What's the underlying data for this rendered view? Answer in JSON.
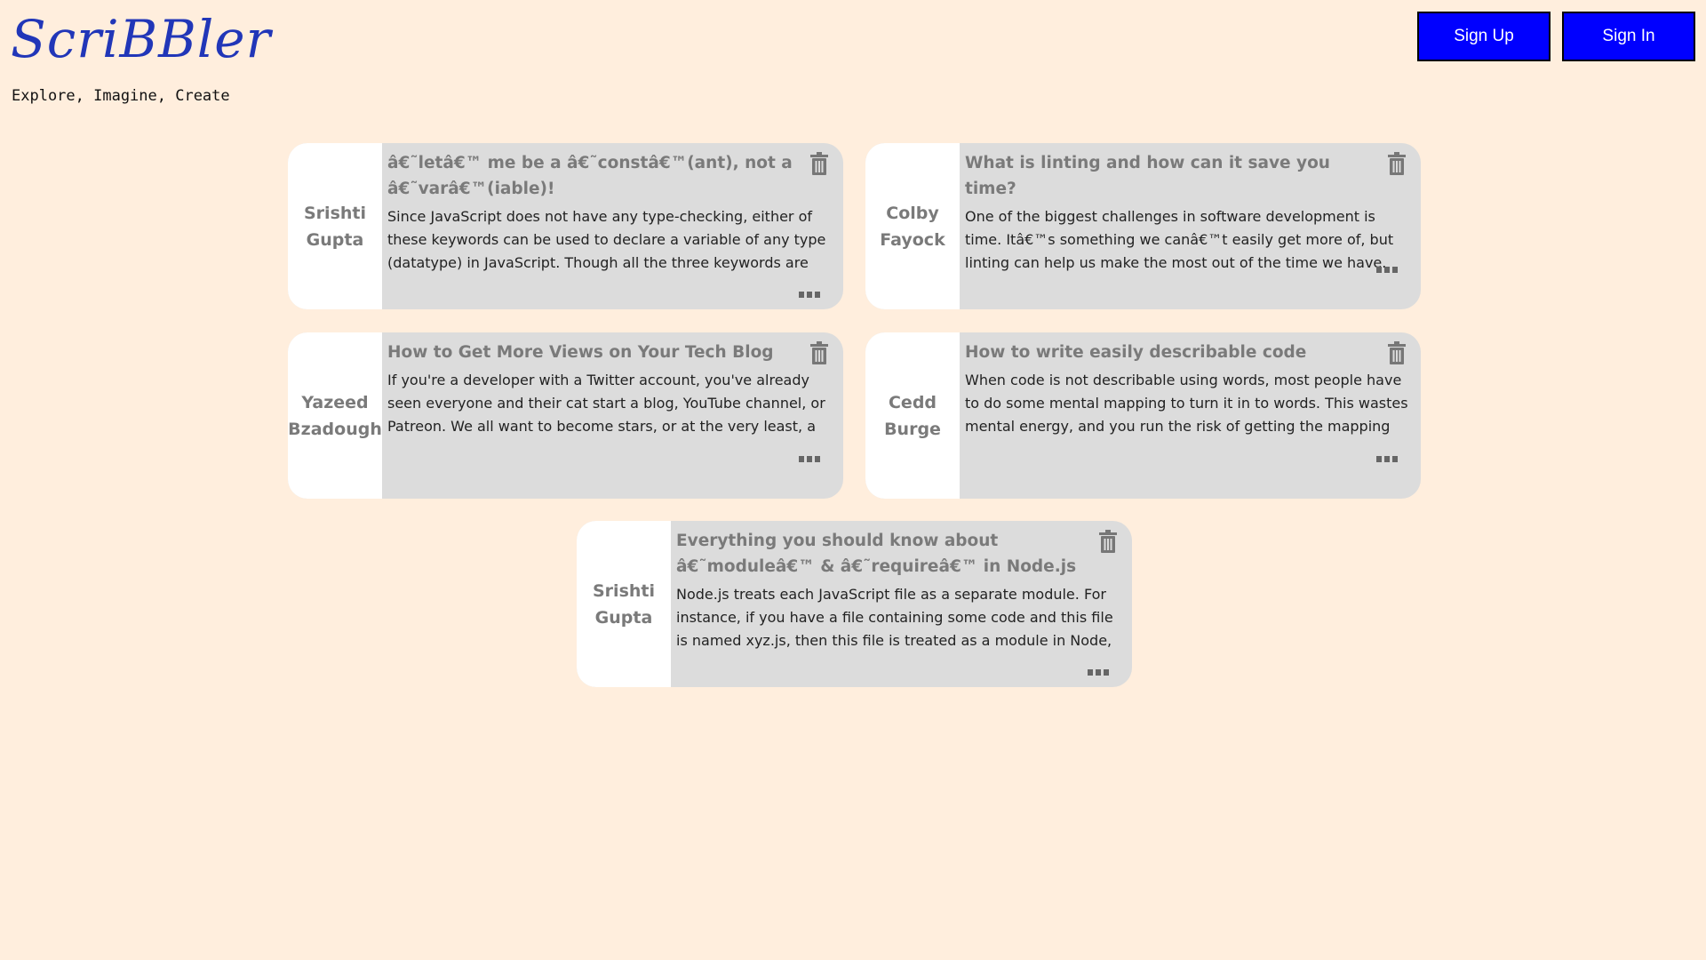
{
  "header": {
    "logo": "ScriBBler",
    "tagline": "Explore, Imagine, Create",
    "signup_label": "Sign Up",
    "signin_label": "Sign In"
  },
  "colors": {
    "background": "#ffeedd",
    "logo": "#2136b8",
    "button": "#0000ff",
    "card": "#dcdcdc"
  },
  "posts": [
    {
      "author": "Srishti Gupta",
      "title": "â€˜letâ€™ me be a â€˜constâ€™(ant), not a â€˜varâ€™(iable)!",
      "text": "Since JavaScript does not have any type-checking, either of these keywords can be used to declare a variable of any type (datatype) in JavaScript. Though all the three keywords are used for the"
    },
    {
      "author": "Colby Fayock",
      "title": "What is linting and how can it save you time?",
      "text": "One of the biggest challenges in software development is time. Itâ€™s something we canâ€™t easily get more of, but linting can help us make the most out of the time we have."
    },
    {
      "author": "Yazeed Bzadough",
      "title": "How to Get More Views on Your Tech Blog",
      "text": "If you're a developer with a Twitter account, you've already seen everyone and their cat start a blog, YouTube channel, or Patreon. We all want to become stars, or at the very least, a recognizable"
    },
    {
      "author": "Cedd Burge",
      "title": "How to write easily describable code",
      "text": "When code is not describable using words, most people have to do some mental mapping to turn it in to words. This wastes mental energy, and you run the risk of getting the mapping"
    },
    {
      "author": "Srishti Gupta",
      "title": "Everything you should know about â€˜moduleâ€™ & â€˜requireâ€™ in Node.js",
      "text": "Node.js treats each JavaScript file as a separate module. For instance, if you have a file containing some code and this file is named xyz.js, then this file is treated as a module in Node, and"
    }
  ]
}
